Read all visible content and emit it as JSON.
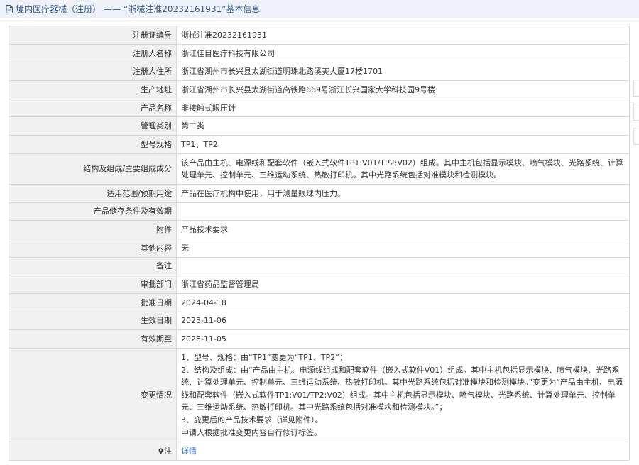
{
  "header": {
    "category": "境内医疗器械（注册）",
    "separator": "——",
    "title": "“浙械注准20232161931”基本信息"
  },
  "rows": [
    {
      "label": "注册证编号",
      "value": "浙械注准20232161931"
    },
    {
      "label": "注册人名称",
      "value": "浙江佳目医疗科技有限公司"
    },
    {
      "label": "注册人住所",
      "value": "浙江省湖州市长兴县太湖街道明珠北路溪美大厦17楼1701"
    },
    {
      "label": "生产地址",
      "value": "浙江省湖州市长兴县太湖街道高铁路669号浙江长兴国家大学科技园9号楼"
    },
    {
      "label": "产品名称",
      "value": "非接触式眼压计"
    },
    {
      "label": "管理类别",
      "value": "第二类"
    },
    {
      "label": "型号规格",
      "value": "TP1、TP2"
    },
    {
      "label": "结构及组成/主要组成成分",
      "value": "该产品由主机、电源线和配套软件（嵌入式软件TP1:V01/TP2:V02）组成。其中主机包括显示模块、喷气模块、光路系统、计算处理单元、控制单元、三维运动系统、热敏打印机。其中光路系统包括对准模块和检测模块。"
    },
    {
      "label": "适用范围/预期用途",
      "value": "产品在医疗机构中使用，用于测量眼球内压力。"
    },
    {
      "label": "产品储存条件及有效期",
      "value": ""
    },
    {
      "label": "附件",
      "value": "产品技术要求"
    },
    {
      "label": "其他内容",
      "value": "无"
    },
    {
      "label": "备注",
      "value": ""
    },
    {
      "label": "审批部门",
      "value": "浙江省药品监督管理局"
    },
    {
      "label": "批准日期",
      "value": "2024-04-18"
    },
    {
      "label": "生效日期",
      "value": "2023-11-06"
    },
    {
      "label": "有效期至",
      "value": "2028-11-05"
    }
  ],
  "change": {
    "label": "变更情况",
    "lines": [
      "1、型号、规格：由“TP1”变更为“TP1、TP2”；",
      "2、结构及组成：由“产品由主机、电源线组成和配套软件（嵌入式软件V01）组成。其中主机包括显示模块、喷气模块、光路系统、计算处理单元、控制单元、三维运动系统、热敏打印机。其中光路系统包括对准模块和检测模块。”变更为“产品由主机、电源线和配套软件（嵌入式软件TP1:V01/TP2:V02）组成。其中主机包括显示模块、喷气模块、光路系统、计算处理单元、控制单元、三维运动系统、热敏打印机。其中光路系统包括对准模块和检测模块。”；",
      "3、变更后的产品技术要求（详见附件）。",
      "申请人根据批准变更内容自行修订标签。"
    ]
  },
  "note": {
    "label": "注",
    "link": "详情"
  },
  "colors": {
    "header_bg": "#eef2f8",
    "header_text": "#335b8c",
    "label_bg": "#f0f0f0",
    "border": "#d9d9d9",
    "link": "#2a6fc9"
  },
  "icons": {
    "header": "document-icon",
    "note": "pin-icon"
  }
}
